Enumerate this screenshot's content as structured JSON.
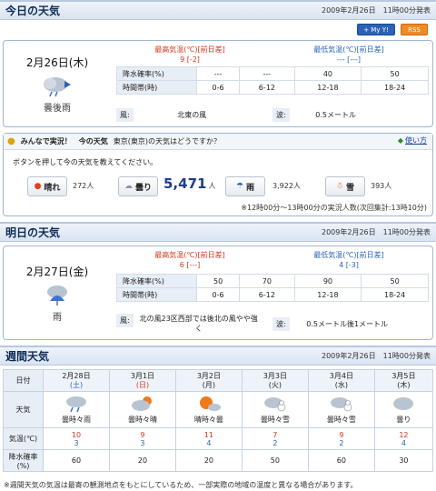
{
  "today": {
    "section_title": "今日の天気",
    "issued": "2009年2月26日　11時00分発表",
    "date": "2月26日(木)",
    "weather": "曇後雨",
    "max_label": "最高気温(℃)[前日差]",
    "max_value": "9 [-2]",
    "min_label": "最低気温(℃)[前日差]",
    "min_value": "--- [---]",
    "rain_label": "降水確率(%)",
    "rain_values": [
      "---",
      "---",
      "40",
      "50"
    ],
    "time_label": "時間帯(時)",
    "time_values": [
      "0-6",
      "6-12",
      "12-18",
      "18-24"
    ],
    "wind_label": "風:",
    "wind_value": "北東の風",
    "wave_label": "波:",
    "wave_value": "0.5メートル",
    "icon": "cloudy-then-rain-icon"
  },
  "badges": {
    "yahoo": "+ My Y!",
    "rss": "RSS"
  },
  "poll": {
    "title": "みんなで実況！　今の天気",
    "question": "東京(東京)の天気はどうですか？",
    "usage": "使い方",
    "instruction": "ボタンを押して今の天気を教えてください。",
    "options": [
      {
        "label": "晴れ",
        "count": "272人",
        "icon": "sun-icon"
      },
      {
        "label": "曇り",
        "count": "5,471",
        "unit": "人",
        "icon": "cloud-icon"
      },
      {
        "label": "雨",
        "count": "3,922人",
        "icon": "umbrella-icon"
      },
      {
        "label": "雪",
        "count": "393人",
        "icon": "snowman-icon"
      }
    ],
    "footer": "※12時00分～13時00分の実況人数(次回集計:13時10分)"
  },
  "tomorrow": {
    "section_title": "明日の天気",
    "issued": "2009年2月26日　11時00分発表",
    "date": "2月27日(金)",
    "weather": "雨",
    "max_label": "最高気温(℃)[前日差]",
    "max_value": "6 [---]",
    "min_label": "最低気温(℃)[前日差]",
    "min_value": "4 [-3]",
    "rain_label": "降水確率(%)",
    "rain_values": [
      "50",
      "70",
      "90",
      "50"
    ],
    "time_label": "時間帯(時)",
    "time_values": [
      "0-6",
      "6-12",
      "12-18",
      "18-24"
    ],
    "wind_label": "風:",
    "wind_value": "北の風23区西部では後北の風やや強く",
    "wave_label": "波:",
    "wave_value": "0.5メートル後1メートル",
    "icon": "rain-icon"
  },
  "weekly": {
    "section_title": "週間天気",
    "issued": "2009年2月26日　11時00分発表",
    "row_labels": {
      "date": "日付",
      "weather": "天気",
      "temp": "気温(℃)",
      "rain": "降水確率(%)"
    },
    "days": [
      {
        "date": "2月28日",
        "dow": "(土)",
        "weather": "曇時々雨",
        "max": "10",
        "min": "3",
        "rain": "60",
        "icon": "cloud-rain-icon"
      },
      {
        "date": "3月1日",
        "dow": "(日)",
        "weather": "曇時々晴",
        "max": "9",
        "min": "3",
        "rain": "20",
        "icon": "cloud-sun-icon"
      },
      {
        "date": "3月2日",
        "dow": "(月)",
        "weather": "晴時々曇",
        "max": "11",
        "min": "4",
        "rain": "20",
        "icon": "sun-cloud-icon"
      },
      {
        "date": "3月3日",
        "dow": "(火)",
        "weather": "曇時々雪",
        "max": "7",
        "min": "2",
        "rain": "50",
        "icon": "cloud-snow-icon"
      },
      {
        "date": "3月4日",
        "dow": "(水)",
        "weather": "曇時々雪",
        "max": "9",
        "min": "2",
        "rain": "60",
        "icon": "cloud-snow-icon"
      },
      {
        "date": "3月5日",
        "dow": "(木)",
        "weather": "曇り",
        "max": "12",
        "min": "4",
        "rain": "30",
        "icon": "cloud-icon"
      }
    ]
  },
  "footnote": "※週間天気の気温は最寄の観測地点をもとにしているため、一部実際の地域の温度と異なる場合があります。",
  "colors": {
    "max": "#d6371e",
    "min": "#2a62b8",
    "header_bg": "#dbe5f3",
    "border": "#9fb6d4"
  }
}
